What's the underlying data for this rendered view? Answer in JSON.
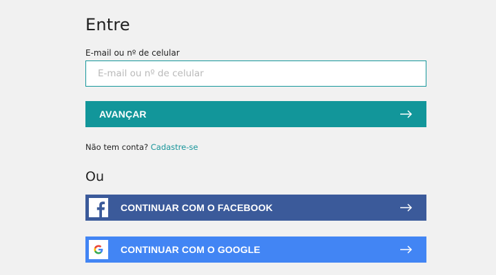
{
  "login": {
    "title": "Entre",
    "email_label": "E-mail ou nº de celular",
    "email_placeholder": "E-mail ou nº de celular",
    "email_value": "",
    "next_button": "AVANÇAR",
    "no_account_text": "Não tem conta?",
    "signup_link": "Cadastre-se",
    "or_label": "Ou",
    "facebook_button": "CONTINUAR COM O FACEBOOK",
    "google_button": "CONTINUAR COM O GOOGLE"
  },
  "colors": {
    "accent": "#12969a",
    "facebook": "#3b5a9a",
    "google": "#4285f4",
    "background": "#f1f1f1"
  },
  "icons": {
    "next": "arrow-right-icon",
    "facebook": "facebook-icon",
    "google": "google-icon"
  }
}
